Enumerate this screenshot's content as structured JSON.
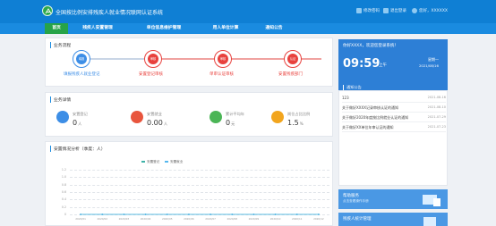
{
  "header": {
    "title": "全国按比例安排残疾人就业情况联网认证系统",
    "links": [
      "修改密码",
      "退出登录"
    ],
    "user": "您好，XXXXXX"
  },
  "nav": {
    "items": [
      "首页",
      "残疾人安置管理",
      "单位信息维护管理",
      "用人单位计算",
      "通知公告"
    ],
    "active_index": 0
  },
  "colors": {
    "header": "#0f7fd4",
    "nav": "#1a8be0",
    "nav_active": "#27a348",
    "step_blue": "#3d8ee6",
    "step_red": "#e8413d",
    "series_1": "#3fb2a8",
    "series_2": "#55b7ee"
  },
  "workflow": {
    "title": "业务流程",
    "steps": [
      {
        "circle": "填报",
        "label": "填报残疾人就业登记"
      },
      {
        "circle": "审核",
        "label": "安置登记审核"
      },
      {
        "circle": "审核",
        "label": "单审认证审核"
      },
      {
        "circle": "认证",
        "label": "安置残疾部门"
      }
    ]
  },
  "stats": {
    "title": "业务详情",
    "items": [
      {
        "icon": "register-icon",
        "label": "安置登记",
        "value": "0",
        "unit": "人"
      },
      {
        "icon": "bank-icon",
        "label": "安置就业",
        "value": "0.00",
        "unit": "人"
      },
      {
        "icon": "money-icon",
        "label": "累计平均年",
        "value": "0",
        "unit": "元"
      },
      {
        "icon": "percent-icon",
        "label": "岗位占比比例",
        "value": "1.5",
        "unit": "%"
      }
    ]
  },
  "chart": {
    "title": "安置情况分析（季度：人）"
  },
  "chart_data": {
    "type": "line",
    "title": "安置情况分析（季度：人）",
    "categories": [
      "2020/01",
      "2020/02",
      "2020/03",
      "2020/04",
      "2020/05",
      "2020/06",
      "2020/07",
      "2020/08",
      "2020/09",
      "2020/10",
      "2020/11",
      "2020/12"
    ],
    "series": [
      {
        "name": "安置登记",
        "values": [
          0,
          0,
          0,
          0,
          0,
          0,
          0,
          0,
          0,
          0,
          0,
          0
        ]
      },
      {
        "name": "安置就业",
        "values": [
          0,
          0,
          0,
          0,
          0,
          0,
          0,
          0,
          0,
          0,
          0,
          0
        ]
      }
    ],
    "ylim": [
      0,
      1.2
    ],
    "yticks": [
      "1.2",
      "1.0",
      "0.8",
      "0.6",
      "0.4",
      "0.2",
      "0"
    ],
    "grid": true,
    "legend": "top"
  },
  "clock": {
    "greeting": "你好XXXX，欢迎您登录系统！",
    "time": "09:59",
    "ampm": "上午",
    "weekday": "星期一",
    "date": "2021/08/16"
  },
  "news": {
    "title": "通知公告",
    "items": [
      {
        "title": "123",
        "date": "2021-08-16"
      },
      {
        "title": "关于做好XXXX记录审核认证的通知",
        "date": "2021-08-10"
      },
      {
        "title": "关于做好2020年度按比例就业认证的通知",
        "date": "2021-07-29"
      },
      {
        "title": "关于做好XX单位年审认证的通知",
        "date": "2021-07-23"
      }
    ]
  },
  "promo1": {
    "title": "帮助服务",
    "subtitle": "点击查看操作手册"
  },
  "promo2": {
    "title": "残疾人统计管理"
  }
}
